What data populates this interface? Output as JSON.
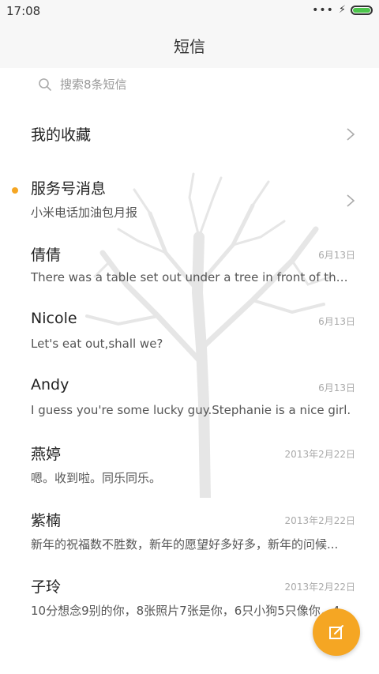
{
  "status_bar": {
    "time": "17:08",
    "battery_level": 1.0
  },
  "header": {
    "title": "短信"
  },
  "search": {
    "placeholder": "搜索8条短信"
  },
  "rows": [
    {
      "title": "我的收藏",
      "subtitle": "",
      "date": "",
      "unread": false,
      "chevron": true
    },
    {
      "title": "服务号消息",
      "subtitle": "小米电话加油包月报",
      "date": "",
      "unread": true,
      "chevron": true
    },
    {
      "title": "倩倩",
      "subtitle": "There was a table set out under a tree in front of the h...",
      "date": "6月13日",
      "unread": false,
      "chevron": false
    },
    {
      "title": "Nicole",
      "subtitle": "Let's eat out,shall we?",
      "date": "6月13日",
      "unread": false,
      "chevron": false
    },
    {
      "title": "Andy",
      "subtitle": "I guess you're some lucky guy.Stephanie is a nice girl.",
      "date": "6月13日",
      "unread": false,
      "chevron": false
    },
    {
      "title": "燕婷",
      "subtitle": "嗯。收到啦。同乐同乐。",
      "date": "2013年2月22日",
      "unread": false,
      "chevron": false
    },
    {
      "title": "紫楠",
      "subtitle": "新年的祝福数不胜数，新年的愿望好多好多，新年的问候...",
      "date": "2013年2月22日",
      "unread": false,
      "chevron": false
    },
    {
      "title": "子玲",
      "subtitle": "10分想念9别的你，8张照片7张是你，6只小狗5只像你，4...",
      "date": "2013年2月22日",
      "unread": false,
      "chevron": false
    }
  ],
  "colors": {
    "accent": "#f5a623",
    "battery": "#4cc54b"
  },
  "icons": {
    "search": "search-icon",
    "compose": "compose-icon",
    "chevron": "chevron-right-icon"
  }
}
